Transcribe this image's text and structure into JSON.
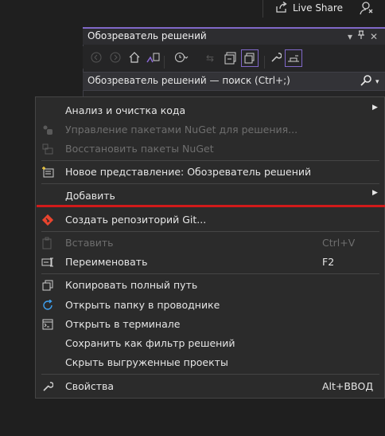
{
  "topbar": {
    "live_share": "Live Share"
  },
  "panel": {
    "title": "Обозреватель решений",
    "title_icons": [
      "dropdown-icon",
      "pin-icon",
      "close-icon"
    ],
    "search_placeholder": "Обозреватель решений — поиск (Ctrl+;)"
  },
  "menu": {
    "items": [
      {
        "label": "Анализ и очистка кода",
        "submenu": true
      },
      {
        "label": "Управление пакетами NuGet для решения...",
        "disabled": true
      },
      {
        "label": "Восстановить пакеты NuGet",
        "disabled": true
      },
      {
        "label": "Новое представление: Обозреватель решений"
      },
      {
        "label": "Добавить",
        "submenu": true
      },
      {
        "label": "Создать репозиторий Git..."
      },
      {
        "label": "Вставить",
        "shortcut": "Ctrl+V",
        "disabled": true
      },
      {
        "label": "Переименовать",
        "shortcut": "F2"
      },
      {
        "label": "Копировать полный путь"
      },
      {
        "label": "Открыть папку в проводнике"
      },
      {
        "label": "Открыть в терминале"
      },
      {
        "label": "Сохранить как фильтр решений"
      },
      {
        "label": "Скрыть выгруженные проекты"
      },
      {
        "label": "Свойства",
        "shortcut": "Alt+ВВОД"
      }
    ]
  },
  "colors": {
    "accent": "#8068c8",
    "highlight_line": "#d11a1a",
    "git_icon": "#e8442e"
  }
}
